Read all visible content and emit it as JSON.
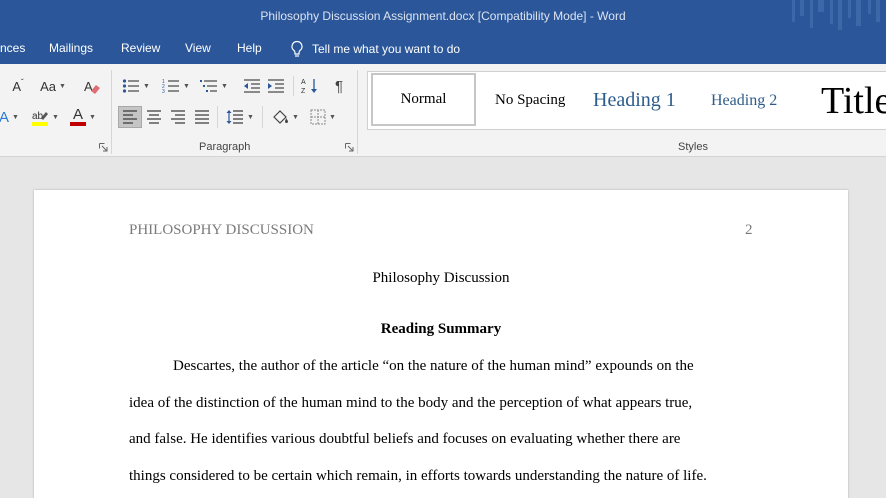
{
  "titlebar": {
    "title": "Philosophy Discussion Assignment.docx [Compatibility Mode]  -  Word"
  },
  "tabs": {
    "items": [
      "nces",
      "Mailings",
      "Review",
      "View",
      "Help"
    ],
    "tell_me": "Tell me what you want to do",
    "icon": "lightbulb-icon"
  },
  "ribbon": {
    "font_group": {
      "grow_label": "A",
      "case_label": "Aa",
      "clear_format_icon": "eraser-icon",
      "text_effects_label": "A",
      "highlight_icon": "highlighter-icon",
      "font_color_label": "A",
      "highlight_color": "#ffff00",
      "font_color": "#c00000"
    },
    "paragraph_group": {
      "label": "Paragraph",
      "bullets_icon": "bullets-icon",
      "numbering_icon": "numbering-icon",
      "multilevel_icon": "multilevel-list-icon",
      "decrease_indent_icon": "decrease-indent-icon",
      "increase_indent_icon": "increase-indent-icon",
      "sort_icon": "sort-icon",
      "pilcrow": "¶",
      "align_left_icon": "align-left-icon",
      "center_icon": "align-center-icon",
      "align_right_icon": "align-right-icon",
      "justify_icon": "justify-icon",
      "line_spacing_icon": "line-spacing-icon",
      "shading_icon": "shading-icon",
      "borders_icon": "borders-icon"
    },
    "styles_group": {
      "label": "Styles",
      "items": [
        "Normal",
        "No Spacing",
        "Heading 1",
        "Heading 2",
        "Title"
      ]
    }
  },
  "document": {
    "running_head": "PHILOSOPHY DISCUSSION",
    "page_number": "2",
    "title": "Philosophy Discussion",
    "heading": "Reading Summary",
    "lines": [
      "Descartes, the author of the article “on the nature of the human mind” expounds on the",
      "idea of the distinction of the human mind to the body and the perception of what appears true,",
      "and false. He identifies various doubtful beliefs and focuses on evaluating whether there are",
      "things considered to be certain which remain, in efforts towards understanding the nature of life."
    ]
  },
  "colors": {
    "word_blue": "#2b579a",
    "heading_blue": "#2e5c8a",
    "ribbon_bg": "#f3f3f3",
    "canvas_bg": "#e6e6e6"
  }
}
